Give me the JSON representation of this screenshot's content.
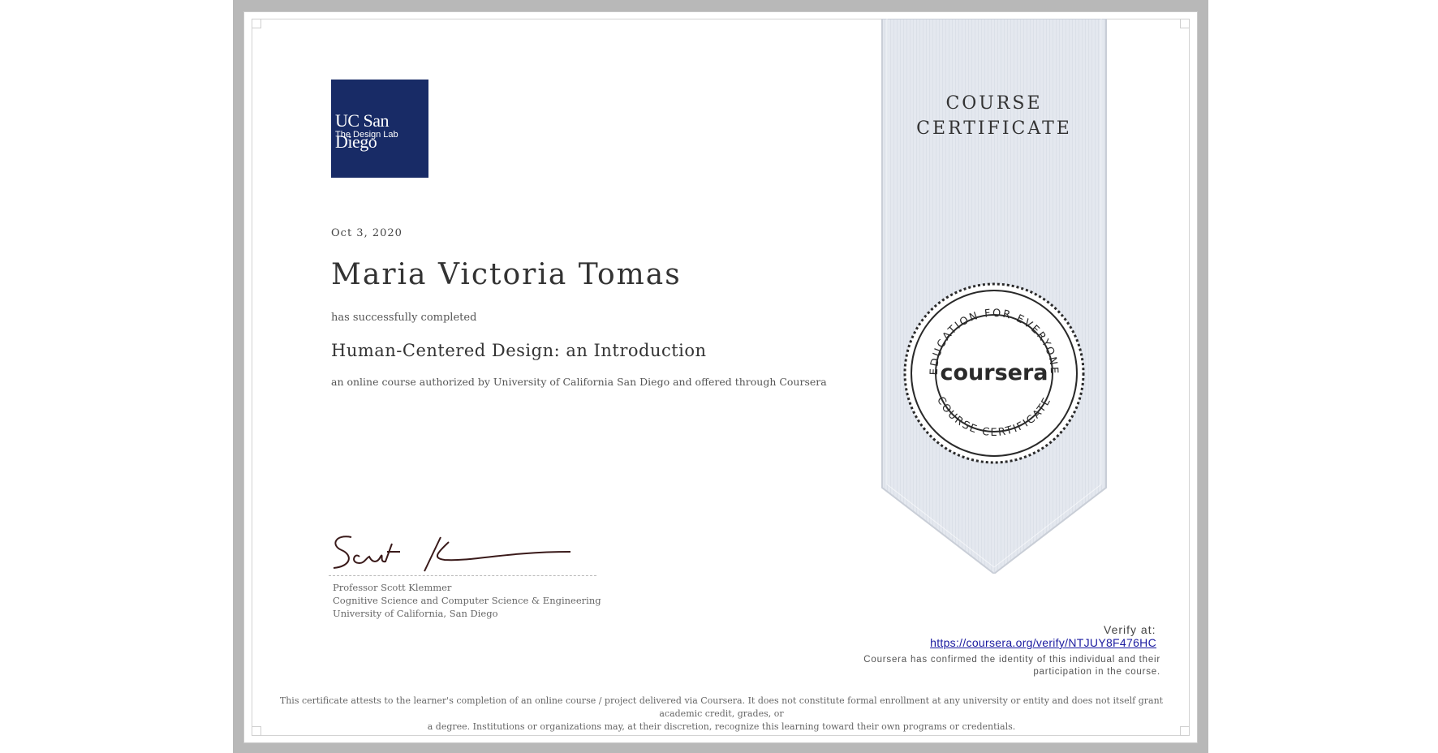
{
  "logo": {
    "institution": "UC San Diego",
    "unit": "The Design Lab",
    "background_color": "#182b66"
  },
  "certificate": {
    "date": "Oct 3, 2020",
    "recipient_name": "Maria Victoria Tomas",
    "completed_text": "has successfully completed",
    "course_title": "Human-Centered Design: an Introduction",
    "authorization_text": "an online course authorized by University of California San Diego and offered through Coursera"
  },
  "signer": {
    "name": "Professor Scott Klemmer",
    "department": "Cognitive Science and Computer Science & Engineering",
    "institution": "University of California, San Diego"
  },
  "ribbon": {
    "title_line1": "COURSE",
    "title_line2": "CERTIFICATE",
    "color": "#e5e9f0"
  },
  "seal": {
    "top_arc": "EDUCATION FOR EVERYONE",
    "center": "coursera",
    "bottom_arc": "COURSE CERTIFICATE",
    "color": "#2a2a2a"
  },
  "verify": {
    "label": "Verify at:",
    "url": "https://coursera.org/verify/NTJUY8F476HC",
    "confirm_line1": "Coursera has confirmed the identity of this individual and their",
    "confirm_line2": "participation in the course."
  },
  "footer": {
    "line1": "This certificate attests to the learner's completion of an online course / project delivered via Coursera. It does not constitute formal enrollment at any university or entity and does not itself grant academic credit, grades, or",
    "line2": "a degree. Institutions or organizations may, at their discretion, recognize this learning toward their own programs or credentials."
  },
  "icons": {
    "signature": "signature-icon",
    "seal": "coursera-seal-icon"
  }
}
